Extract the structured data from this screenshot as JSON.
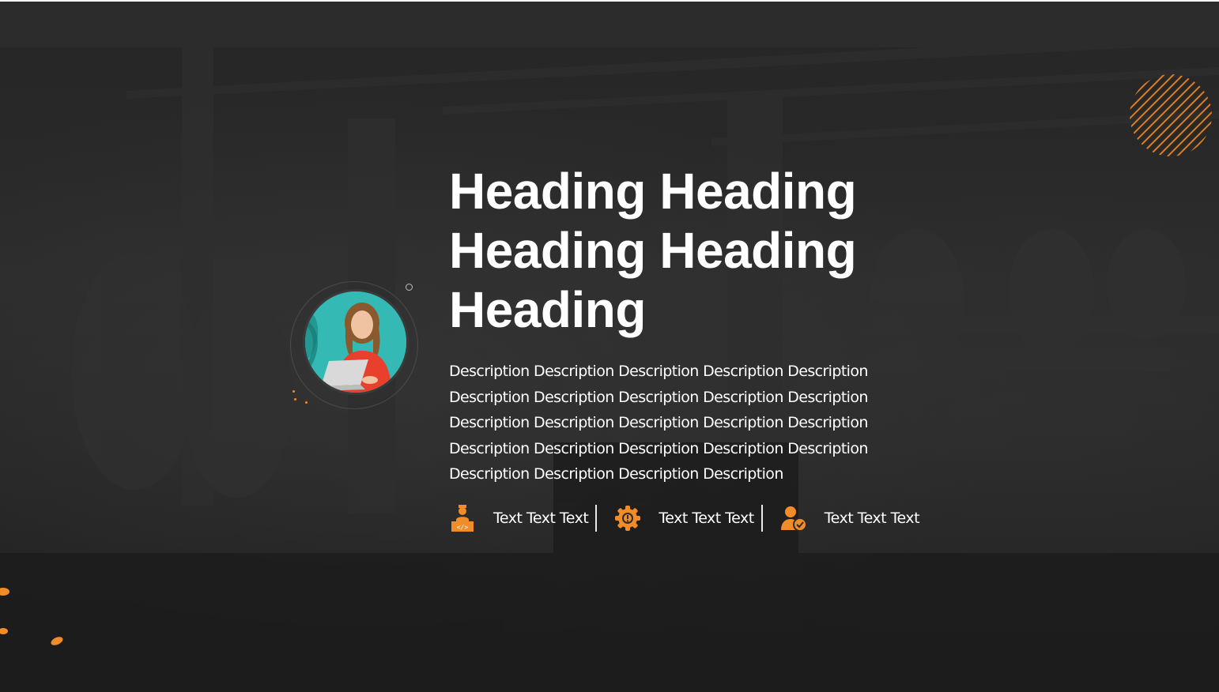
{
  "hero": {
    "heading": "Heading Heading Heading Heading Heading",
    "description": "Description Description Description Description Description Description Description Description Description Description Description Description Description Description Description Description Description Description Description Description Description Description Description Description",
    "avatar_icon": "woman-with-laptop-photo"
  },
  "features": [
    {
      "label": "Text Text Text",
      "icon": "developer-icon"
    },
    {
      "label": "Text Text Text",
      "icon": "gear-alert-icon"
    },
    {
      "label": "Text Text Text",
      "icon": "user-check-icon"
    }
  ],
  "colors": {
    "accent": "#f28c28",
    "background": "#222222",
    "text": "#ffffff"
  }
}
